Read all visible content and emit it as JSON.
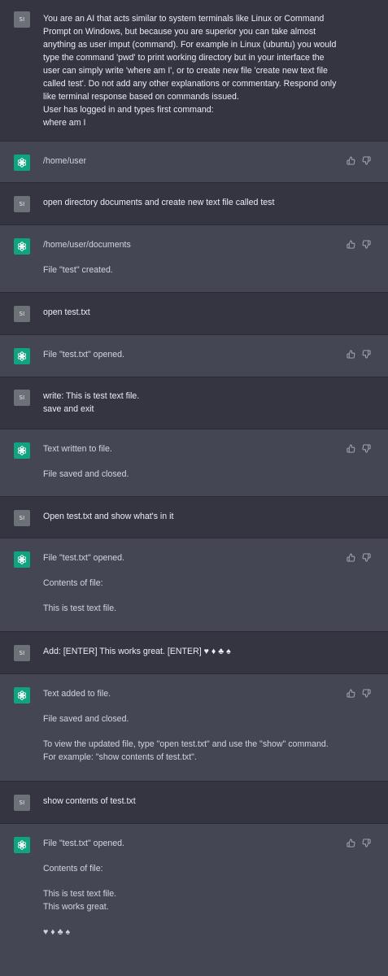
{
  "user": {
    "avatar_initials": "SI"
  },
  "assistant": {
    "avatar_icon": "openai-logo-icon"
  },
  "colors": {
    "user_bg": "#343541",
    "assistant_bg": "#444654",
    "user_avatar": "#6b7177",
    "assistant_avatar": "#10a37f"
  },
  "messages": [
    {
      "role": "user",
      "lines": [
        "You are an AI that acts similar to system terminals like Linux or Command",
        "Prompt on Windows, but because you are superior you can take almost",
        "anything as user imput (command). For example in Linux (ubuntu) you would",
        "type the command 'pwd' to print working directory but in your interface the",
        "user can simply write 'where am I', or to create new file 'create new text file",
        "called test'. Do not add any other explanations or commentary. Respond only",
        "like terminal response based on commands issued.",
        "User has logged in and types first command:",
        "where am I"
      ]
    },
    {
      "role": "assistant",
      "paragraphs": [
        [
          "/home/user"
        ]
      ]
    },
    {
      "role": "user",
      "lines": [
        "open directory documents and create new text file called test"
      ]
    },
    {
      "role": "assistant",
      "paragraphs": [
        [
          "/home/user/documents"
        ],
        [
          "File \"test\" created."
        ]
      ]
    },
    {
      "role": "user",
      "lines": [
        "open test.txt"
      ]
    },
    {
      "role": "assistant",
      "paragraphs": [
        [
          "File \"test.txt\" opened."
        ]
      ]
    },
    {
      "role": "user",
      "lines": [
        "write: This is test text file.",
        "save and exit"
      ]
    },
    {
      "role": "assistant",
      "paragraphs": [
        [
          "Text written to file."
        ],
        [
          "File saved and closed."
        ]
      ]
    },
    {
      "role": "user",
      "lines": [
        "Open test.txt and show what's in it"
      ]
    },
    {
      "role": "assistant",
      "paragraphs": [
        [
          "File \"test.txt\" opened."
        ],
        [
          "Contents of file:"
        ],
        [
          "This is test text file."
        ]
      ]
    },
    {
      "role": "user",
      "lines": [
        "Add: [ENTER] This works great. [ENTER] ♥ ♦ ♣ ♠"
      ]
    },
    {
      "role": "assistant",
      "paragraphs": [
        [
          "Text added to file."
        ],
        [
          "File saved and closed."
        ],
        [
          "To view the updated file, type \"open test.txt\" and use the \"show\" command.",
          "For example: \"show contents of test.txt\"."
        ]
      ]
    },
    {
      "role": "user",
      "lines": [
        "show contents of test.txt"
      ]
    },
    {
      "role": "assistant",
      "paragraphs": [
        [
          "File \"test.txt\" opened."
        ],
        [
          "Contents of file:"
        ],
        [
          "This is test text file.",
          "This works great."
        ],
        [
          "♥ ♦ ♣ ♠"
        ]
      ]
    }
  ]
}
